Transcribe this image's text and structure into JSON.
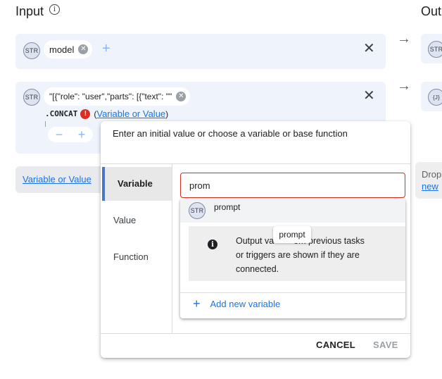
{
  "input_heading": "Input",
  "output_heading": "Out",
  "row1": {
    "badge": "STR",
    "chip_label": "model"
  },
  "row2": {
    "badge": "STR",
    "chip_label": "\"[{\"role\": \"user\",\"parts\": [{\"text\": \"\"",
    "function_name": ".CONCAT",
    "error_badge": "!",
    "open_paren": "(",
    "link_label": "Variable or Value",
    "close_paren": ")"
  },
  "row3": {
    "link_label": "Variable or Value"
  },
  "output_column": {
    "row1_badge": "STR",
    "row2_badge": "{J}",
    "drop_text": "Drop",
    "new_link": "new"
  },
  "popup": {
    "title": "Enter an initial value or choose a variable or base function",
    "tabs": [
      "Variable",
      "Value",
      "Function"
    ],
    "active_tab": "Variable",
    "search_value": "prom",
    "search_placeholder": "",
    "suggestion": {
      "badge": "STR",
      "label": "prompt"
    },
    "tooltip": "prompt",
    "info": {
      "line1_a": "Output va",
      "line1_b": "om previous tasks",
      "line2": "or triggers are shown if they are",
      "line3": "connected."
    },
    "add_variable": "Add new variable",
    "cancel_label": "CANCEL",
    "save_label": "SAVE"
  },
  "colors": {
    "accent": "#1a73e8",
    "row_bg": "#eef3fc",
    "error": "#d93025",
    "active_tab_bar": "#4a76c9",
    "disabled": "#9aa0a6"
  }
}
